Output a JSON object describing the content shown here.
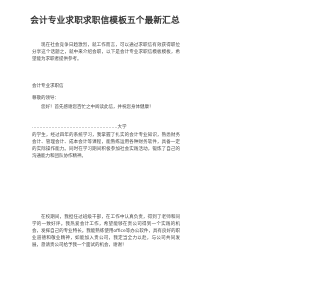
{
  "document": {
    "title": "会计专业求职求职信模板五个最新汇总",
    "intro": "现在社会竞争日趋激烈，就工作而言，可以通过求职信有效获得职位分享这个话题之，就中来介绍会职，以下是会计专业求职信模板模板，希望能为求职者提供参考。",
    "label": "会计专业求职信",
    "salutation": "尊敬的领导：",
    "greeting": "您好！首先感谢您百忙之中阅读此信，并祝您身体健康！",
    "dots": "…………………………………………………大学",
    "paragraph2": "的学生，经过四年的系统学习，我掌握了扎实的会计专业知识，熟悉财务会计、管理会计、成本会计等课程，能熟练运用各种财务软件，具备一定的实际操作能力。同时在学习期间积极参加社会实践活动，锻炼了自己的沟通能力和团队协作精神。",
    "paragraph3": "在校期间，我担任过班级干部，在工作中认真负责，得到了老师和同学的一致好评。我热爱会计工作，希望能够在贵公司得到一个实践的机会，发挥自己的专业特长。我能熟练使用office等办公软件，具有良好的职业道德和敬业精神，如能加入贵公司，我定当全力以赴，与公司共同发展，恳请贵公司给予我一个面试的机会，谢谢！"
  }
}
